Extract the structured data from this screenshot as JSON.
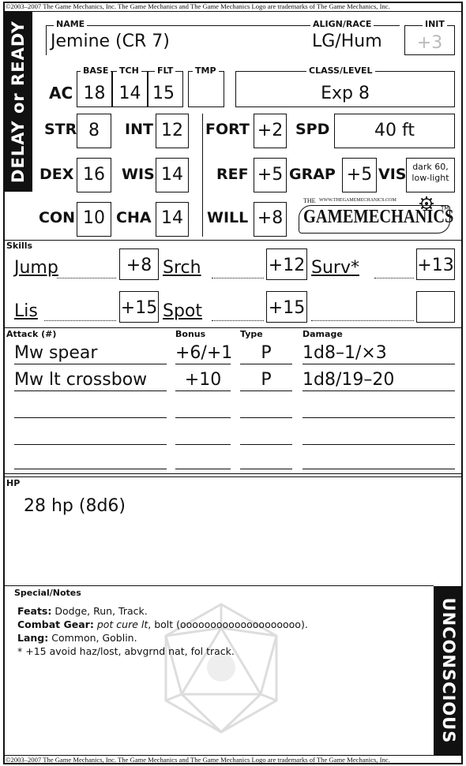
{
  "copyright": "©2003–2007 The Game Mechanics, Inc. The Game Mechanics and The Game Mechanics Logo are trademarks of The Game Mechanics, Inc.",
  "side_band_left": "DELAY or READY",
  "side_band_right": "UNCONSCIOUS",
  "header": {
    "name_label": "NAME",
    "name": "Jemine (CR 7)",
    "align_label": "ALIGN/RACE",
    "align": "LG/Hum",
    "init_label": "INIT",
    "init": "+3"
  },
  "ac": {
    "label": "AC",
    "base_label": "BASE",
    "base": "18",
    "tch_label": "TCH",
    "tch": "14",
    "flt_label": "FLT",
    "flt": "15",
    "tmp_label": "TMP",
    "tmp": "",
    "class_label": "CLASS/LEVEL",
    "class": "Exp 8"
  },
  "abilities": [
    {
      "label": "STR",
      "value": "8"
    },
    {
      "label": "INT",
      "value": "12"
    },
    {
      "label": "DEX",
      "value": "16"
    },
    {
      "label": "WIS",
      "value": "14"
    },
    {
      "label": "CON",
      "value": "10"
    },
    {
      "label": "CHA",
      "value": "14"
    }
  ],
  "saves": [
    {
      "label": "FORT",
      "value": "+2"
    },
    {
      "label": "REF",
      "value": "+5"
    },
    {
      "label": "WILL",
      "value": "+8"
    }
  ],
  "spd_label": "SPD",
  "spd": "40 ft",
  "grap_label": "GRAP",
  "grap": "+5",
  "vis_label": "VIS",
  "vis": "dark 60, low-light",
  "logo": {
    "url_text": "WWW.THEGAMEMECHANICS.COM",
    "the": "THE",
    "text": "GAMEMECHANICS",
    "tm": "TM"
  },
  "skills_label": "Skills",
  "skills": [
    {
      "name": "Jump",
      "mod": "+8"
    },
    {
      "name": "Srch",
      "mod": "+12"
    },
    {
      "name": "Surv*",
      "mod": "+13"
    },
    {
      "name": "Lis",
      "mod": "+15"
    },
    {
      "name": "Spot",
      "mod": "+15"
    },
    {
      "name": "",
      "mod": ""
    }
  ],
  "attack": {
    "col_attack": "Attack (#)",
    "col_bonus": "Bonus",
    "col_type": "Type",
    "col_damage": "Damage",
    "rows": [
      {
        "name": "Mw spear",
        "bonus": "+6/+1",
        "type": "P",
        "damage": "1d8–1/×3"
      },
      {
        "name": "Mw lt crossbow",
        "bonus": "+10",
        "type": "P",
        "damage": "1d8/19–20"
      },
      {
        "name": "",
        "bonus": "",
        "type": "",
        "damage": ""
      },
      {
        "name": "",
        "bonus": "",
        "type": "",
        "damage": ""
      }
    ]
  },
  "hp_label": "HP",
  "hp": "28 hp (8d6)",
  "notes": {
    "label": "Special/Notes",
    "lines": [
      {
        "bold": "Feats:",
        "text": " Dodge, Run, Track.",
        "italic": ""
      },
      {
        "bold": "Combat Gear:",
        "italic": " pot cure lt",
        "text": ", bolt (oooooooooooooooooooo)."
      },
      {
        "bold": "Lang:",
        "text": " Common, Goblin.",
        "italic": ""
      },
      {
        "bold": "",
        "text": "* +15 avoid haz/lost, abvgrnd nat, fol track.",
        "italic": ""
      }
    ]
  }
}
